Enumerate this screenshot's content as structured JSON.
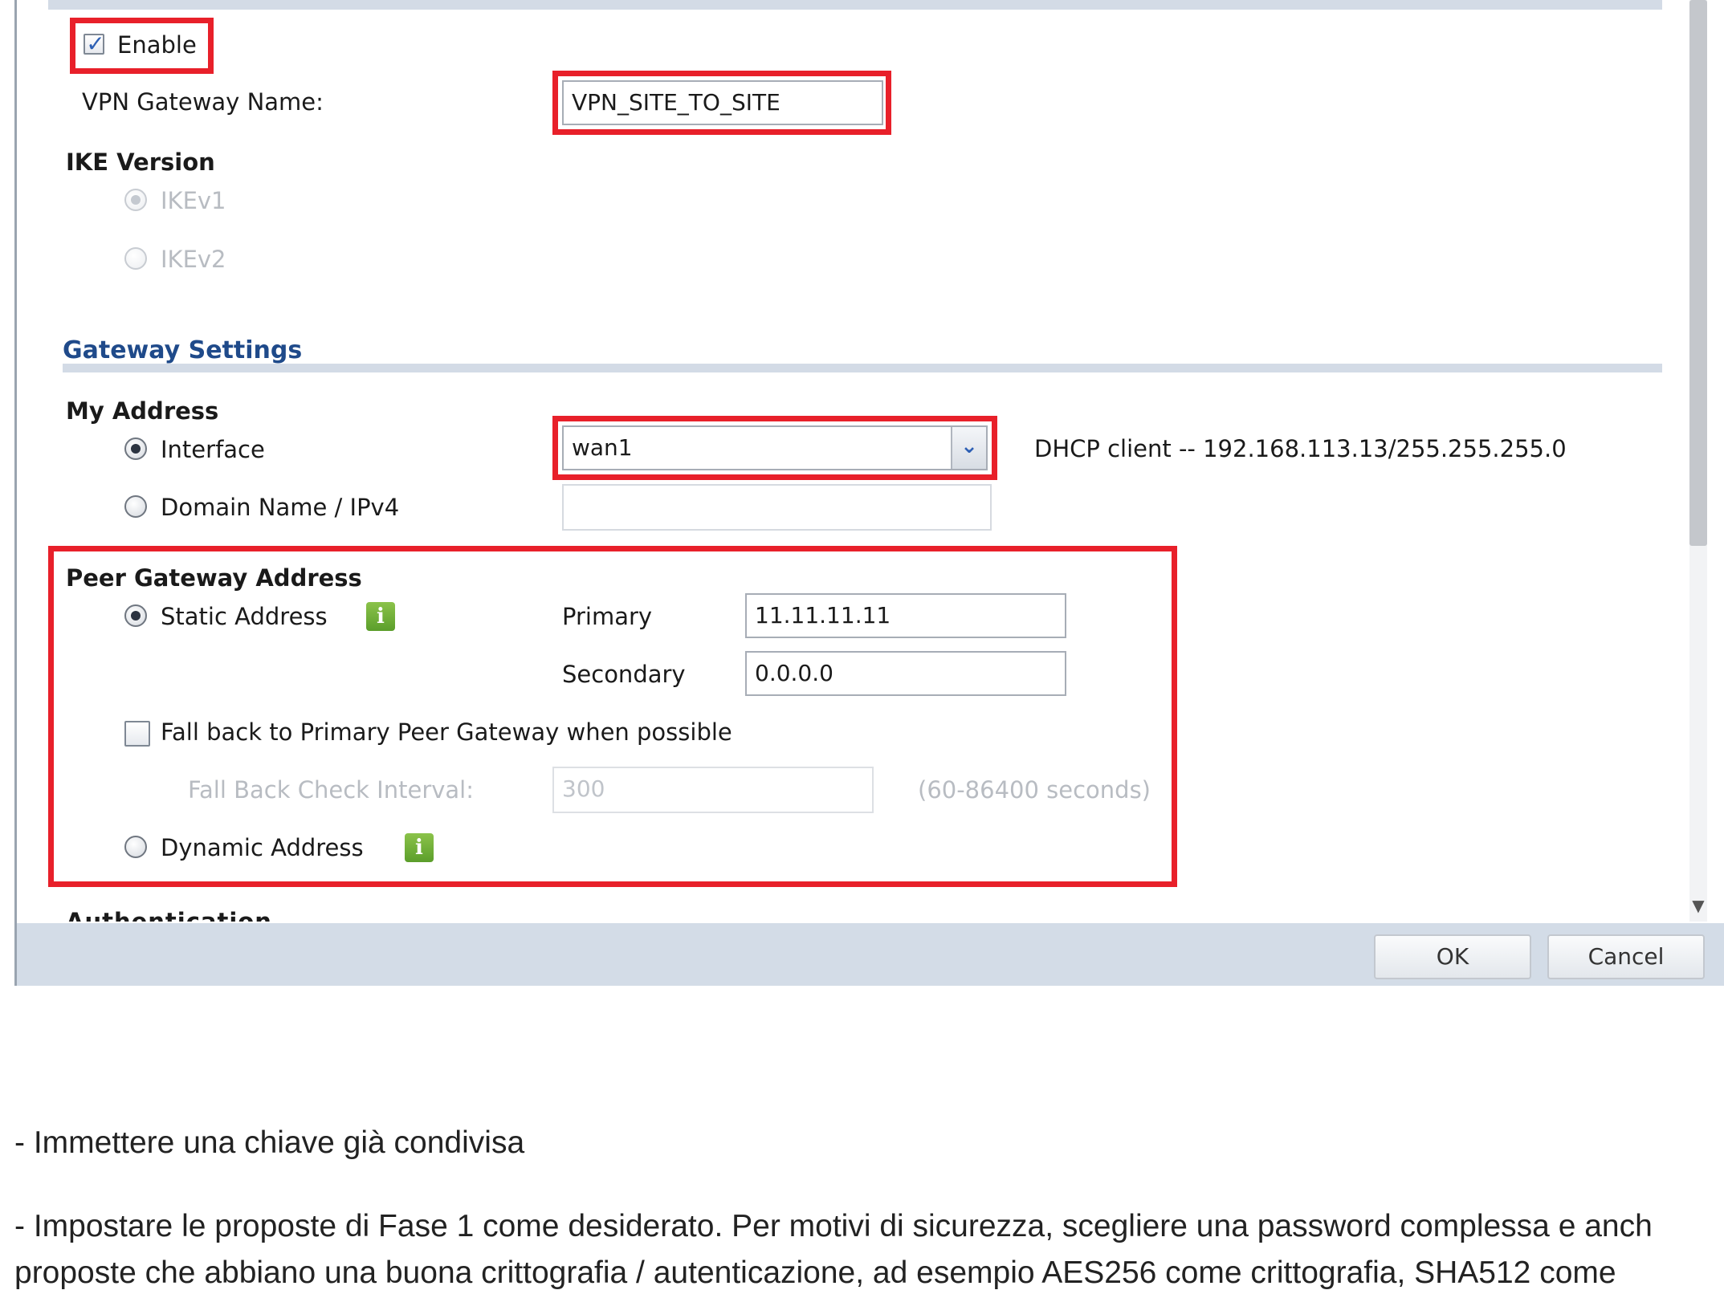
{
  "dialog": {
    "enable": {
      "label": "Enable",
      "checked": true
    },
    "vpn_gateway_name": {
      "label": "VPN Gateway Name:",
      "value": "VPN_SITE_TO_SITE"
    },
    "ike_version": {
      "heading": "IKE Version",
      "options": [
        {
          "label": "IKEv1",
          "selected": true,
          "disabled": true
        },
        {
          "label": "IKEv2",
          "selected": false,
          "disabled": true
        }
      ]
    },
    "gateway_settings": {
      "title": "Gateway Settings",
      "my_address": {
        "heading": "My Address",
        "interface": {
          "label": "Interface",
          "selected": true,
          "value": "wan1",
          "info": "DHCP client -- 192.168.113.13/255.255.255.0"
        },
        "domain_name": {
          "label": "Domain Name / IPv4",
          "selected": false,
          "value": ""
        }
      },
      "peer_gateway_address": {
        "heading": "Peer Gateway Address",
        "static_address": {
          "label": "Static Address",
          "selected": true
        },
        "primary": {
          "label": "Primary",
          "value": "11.11.11.11"
        },
        "secondary": {
          "label": "Secondary",
          "value": "0.0.0.0"
        },
        "fall_back": {
          "label": "Fall back to Primary Peer Gateway when possible",
          "checked": false
        },
        "fall_back_interval": {
          "label": "Fall Back Check Interval:",
          "value": "300",
          "range": "(60-86400 seconds)"
        },
        "dynamic_address": {
          "label": "Dynamic Address",
          "selected": false
        }
      },
      "next_section_partial": "Authentication"
    },
    "buttons": {
      "ok": "OK",
      "cancel": "Cancel"
    }
  },
  "article": {
    "lines": [
      "- Immettere una chiave già condivisa",
      "- Impostare le proposte di Fase 1 come desiderato. Per motivi di sicurezza, scegliere una password complessa e anch",
      "proposte che abbiano una buona crittografia / autenticazione, ad esempio AES256 come crittografia, SHA512 come"
    ]
  },
  "colors": {
    "highlight": "#e8202a",
    "section_title": "#1f4a8a",
    "info_icon": "#6aab35",
    "footer": "#d3dce7"
  },
  "icons": {
    "info": "i",
    "dropdown": "chevron-down-icon",
    "scroll_down": "triangle-down-icon"
  }
}
